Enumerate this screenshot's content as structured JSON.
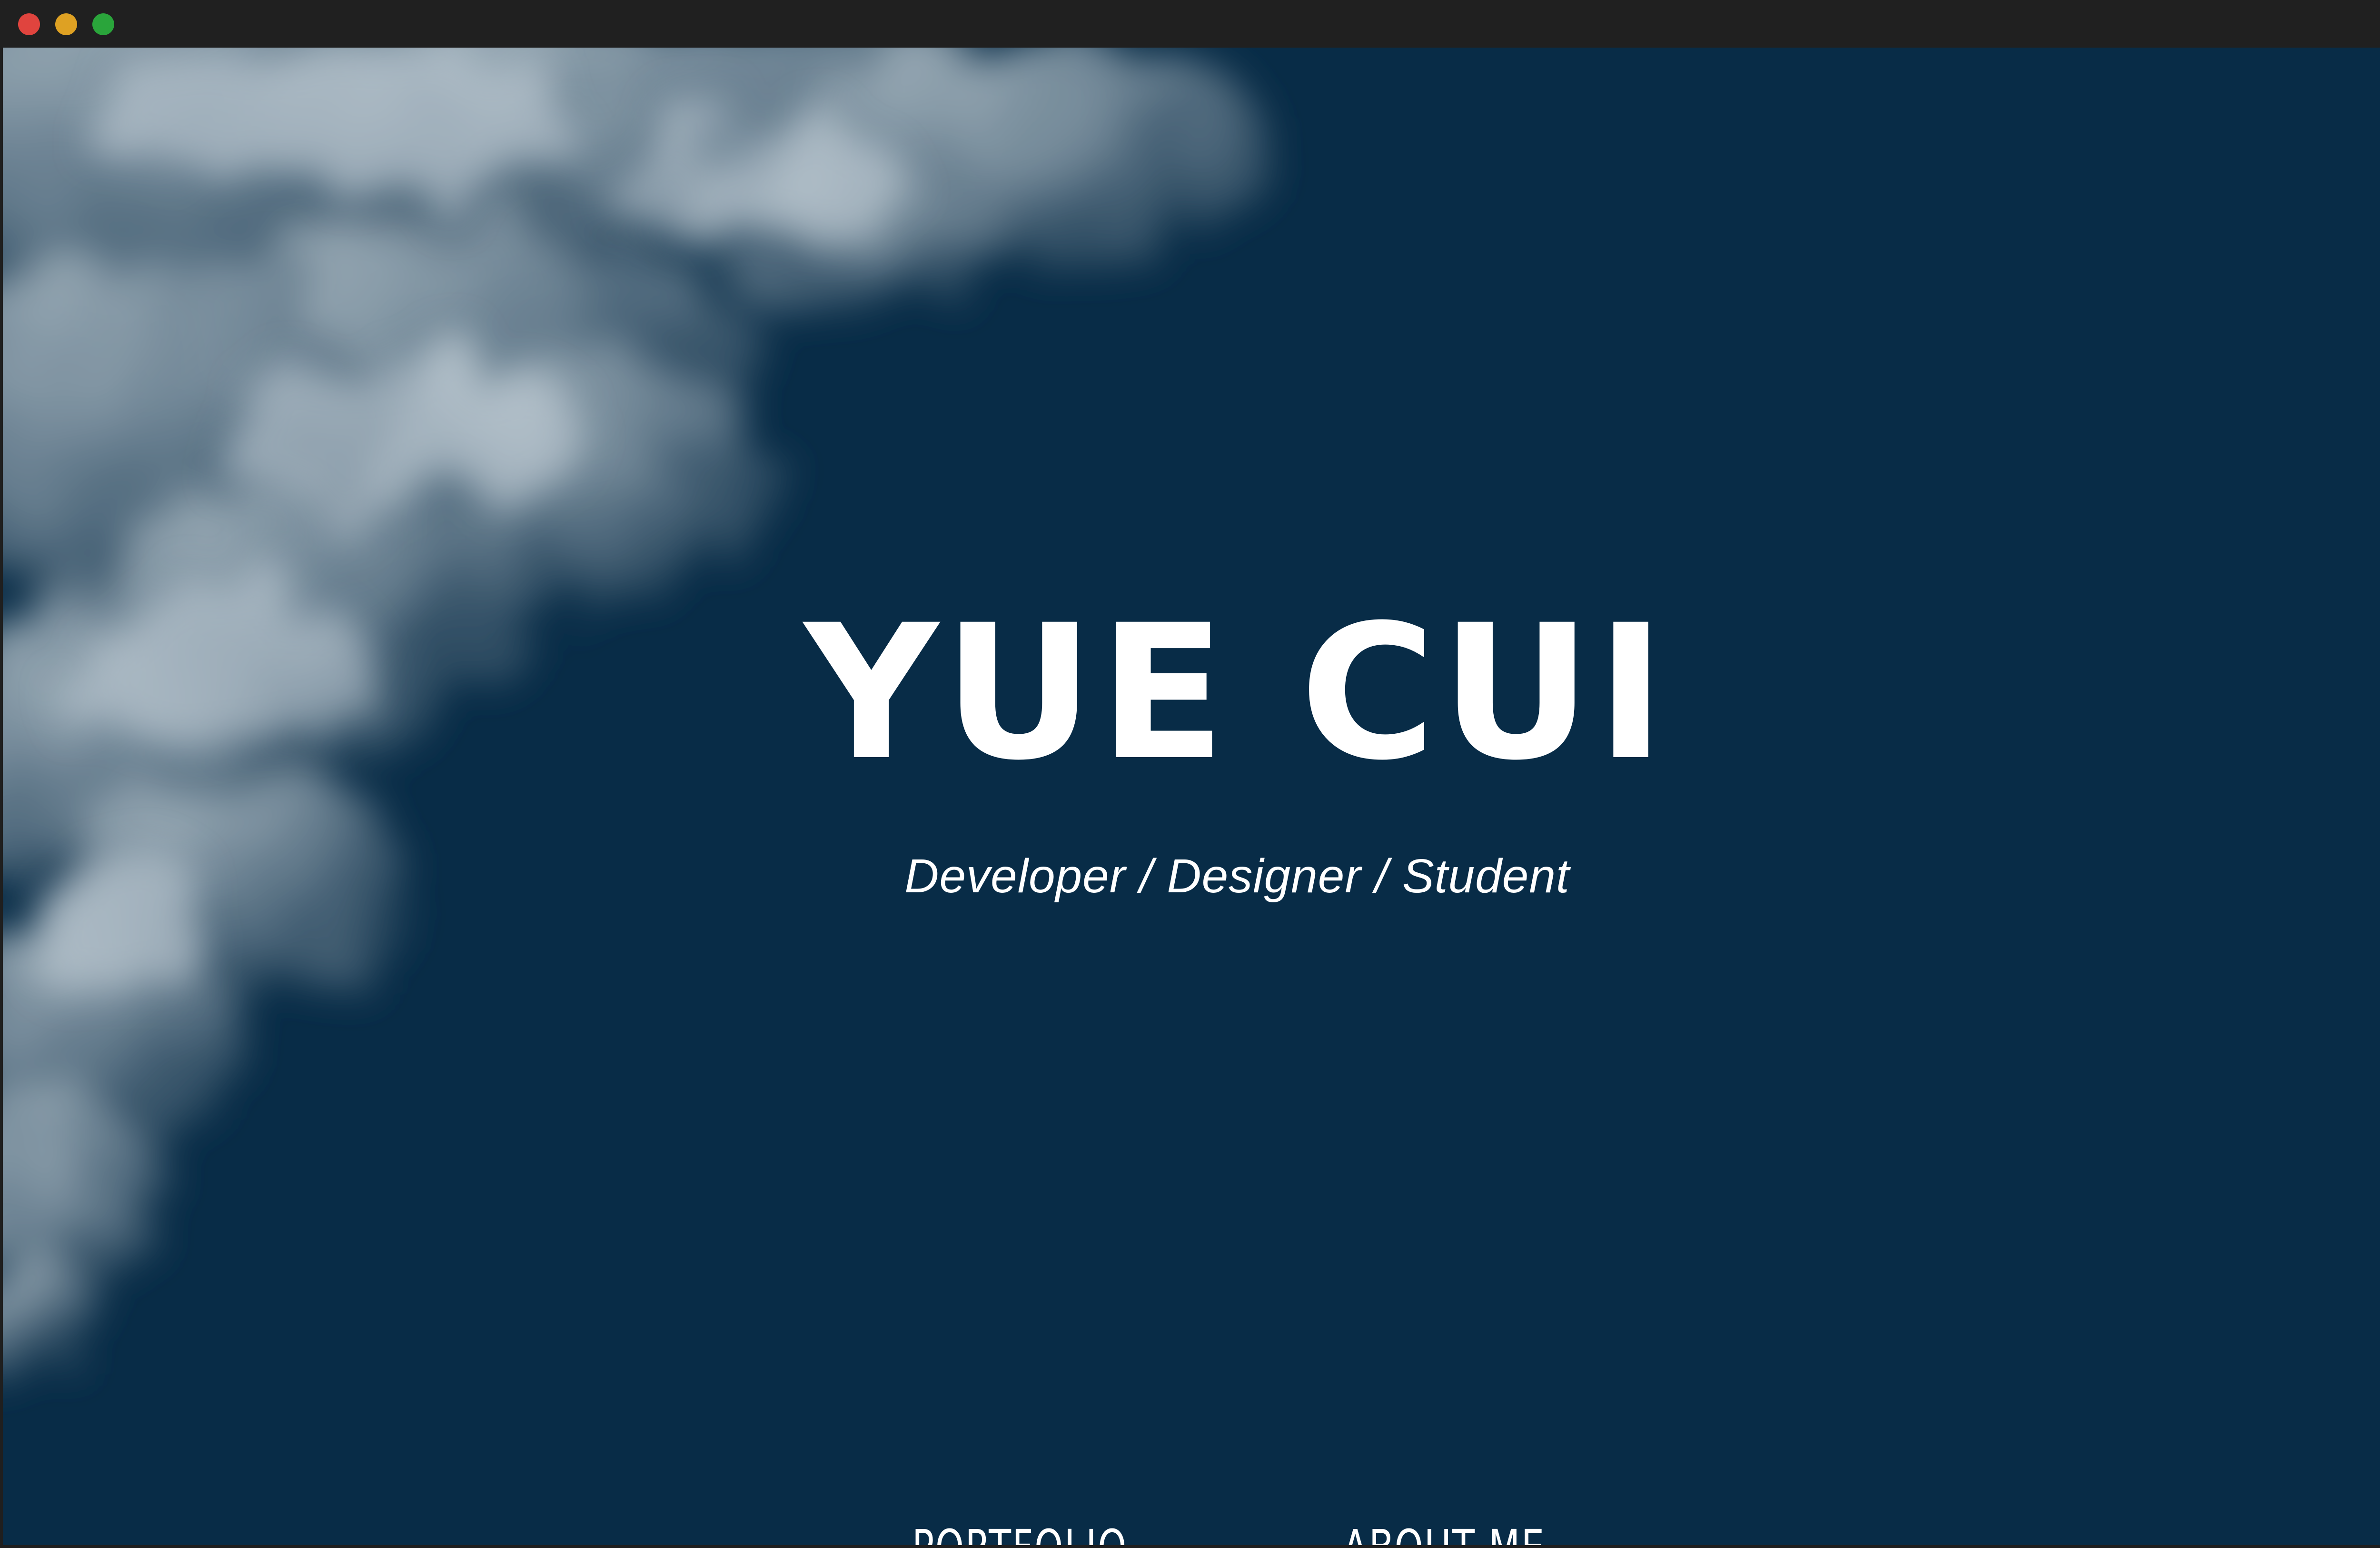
{
  "window": {
    "controls": [
      "close",
      "minimize",
      "maximize"
    ]
  },
  "hero": {
    "title": "YUE CUI",
    "subtitle": "Developer / Designer / Student"
  },
  "nav": {
    "portfolio_label": "PORTFOLIO",
    "about_label": "ABOUT ME"
  },
  "colors": {
    "background": "#082c47",
    "text": "#ffffff",
    "cloud": "#c9d2d8"
  }
}
